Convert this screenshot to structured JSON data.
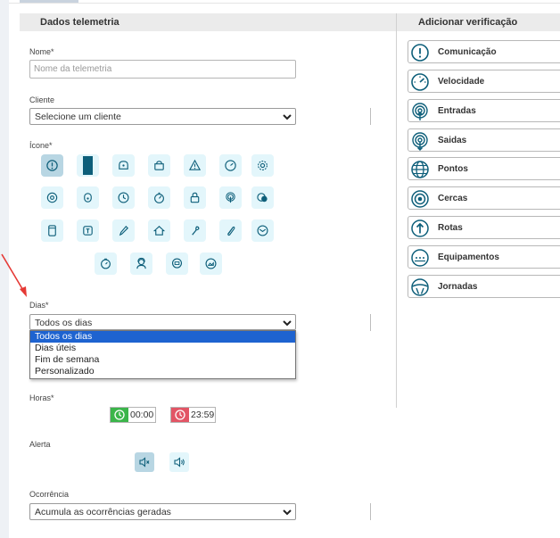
{
  "colors": {
    "accent": "#0e5f7a",
    "icon_bg": "#e3f6fb",
    "icon_selected_bg": "#b8d6e3",
    "dropdown_highlight": "#1e63d0",
    "start_green": "#3bb54a",
    "end_red": "#e25565",
    "arrow_red": "#e53935"
  },
  "left_panel": {
    "title": "Dados telemetria",
    "nome": {
      "label": "Nome*",
      "placeholder": "Nome da telemetria",
      "value": ""
    },
    "cliente": {
      "label": "Cliente",
      "value": "Selecione um cliente"
    },
    "icone": {
      "label": "Ícone*",
      "icons": [
        "alert-circle-icon",
        "bar-icon",
        "shield-lock-icon",
        "lock-icon",
        "warning-triangle-icon",
        "speedometer-icon",
        "gear-icon",
        "disc-icon",
        "lock-round-icon",
        "clock-icon",
        "gauge-icon",
        "padlock-icon",
        "fingerprint-icon",
        "toggle-icon",
        "phone-icon",
        "battery-icon",
        "pencil-icon",
        "home-icon",
        "wrench-icon",
        "paperclip-icon",
        "envelope-icon",
        "timer-icon",
        "user-headset-icon",
        "message-icon",
        "photo-icon"
      ],
      "selected_icon": "alert-circle-icon"
    },
    "dias": {
      "label": "Dias*",
      "value": "Todos os dias",
      "options": [
        "Todos os dias",
        "Dias úteis",
        "Fim de semana",
        "Personalizado"
      ],
      "highlighted": "Todos os dias"
    },
    "horas": {
      "label": "Horas*",
      "start": "00:00",
      "end": "23:59"
    },
    "alerta": {
      "label": "Alerta",
      "options": [
        "mute-icon",
        "sound-icon"
      ],
      "selected": "mute-icon"
    },
    "ocorrencia": {
      "label": "Ocorrência",
      "value": "Acumula as ocorrências geradas"
    }
  },
  "right_panel": {
    "title": "Adicionar verificação",
    "items": [
      {
        "label": "Comunicação",
        "icon": "exclamation-icon"
      },
      {
        "label": "Velocidade",
        "icon": "speedometer-icon"
      },
      {
        "label": "Entradas",
        "icon": "signal-in-icon"
      },
      {
        "label": "Saidas",
        "icon": "signal-out-icon"
      },
      {
        "label": "Pontos",
        "icon": "globe-icon"
      },
      {
        "label": "Cercas",
        "icon": "target-icon"
      },
      {
        "label": "Rotas",
        "icon": "route-arrow-icon"
      },
      {
        "label": "Equipamentos",
        "icon": "dots-screen-icon"
      },
      {
        "label": "Jornadas",
        "icon": "steering-wheel-icon"
      }
    ]
  }
}
